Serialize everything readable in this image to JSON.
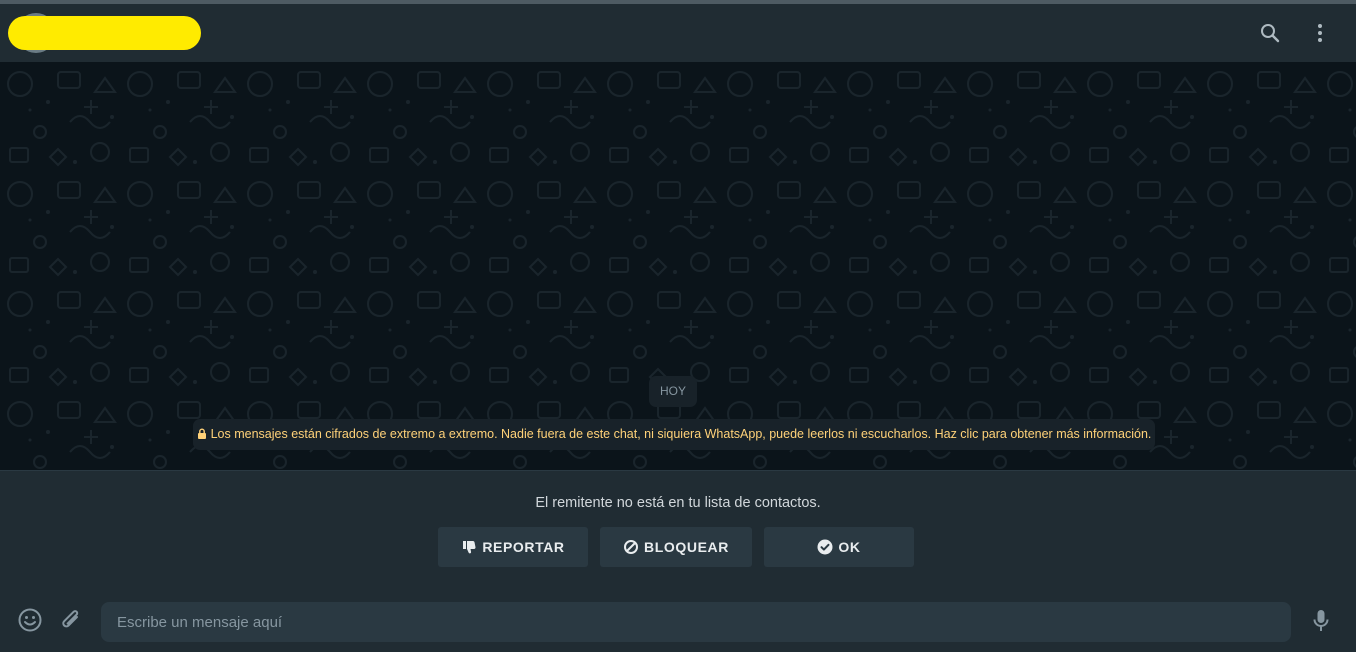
{
  "header": {
    "contact_name": "",
    "icons": [
      "search-icon",
      "menu-kebab-icon"
    ]
  },
  "chat": {
    "day_label": "HOY",
    "encryption_notice": "Los mensajes están cifrados de extremo a extremo. Nadie fuera de este chat, ni siquiera WhatsApp, puede leerlos ni escucharlos. Haz clic para obtener más información.",
    "notice_color": "#ffd279"
  },
  "unknown_sender": {
    "message": "El remitente no está en tu lista de contactos.",
    "report_label": "REPORTAR",
    "block_label": "BLOQUEAR",
    "ok_label": "OK"
  },
  "composer": {
    "placeholder": "Escribe un mensaje aquí",
    "icons": [
      "emoji-icon",
      "attach-icon",
      "microphone-icon"
    ]
  },
  "colors": {
    "header_bg": "#202c33",
    "chat_bg": "#0b141a",
    "button_bg": "#2a3942"
  }
}
